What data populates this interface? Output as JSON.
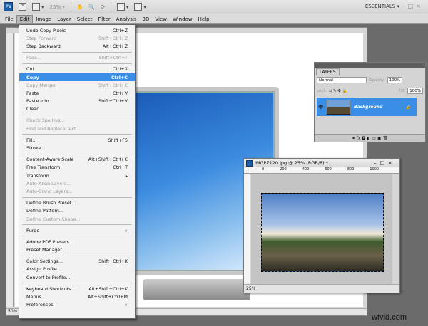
{
  "appbar": {
    "logo": "Ps",
    "bridge": "Br",
    "zoom": "25%",
    "workspace": "ESSENTIALS ▾",
    "window_controls": "–□×"
  },
  "menubar": [
    "File",
    "Edit",
    "Image",
    "Layer",
    "Select",
    "Filter",
    "Analysis",
    "3D",
    "View",
    "Window",
    "Help"
  ],
  "edit_menu": {
    "groups": [
      [
        {
          "label": "Undo Copy Pixels",
          "shortcut": "Ctrl+Z"
        },
        {
          "label": "Step Forward",
          "shortcut": "Shift+Ctrl+Z",
          "disabled": true
        },
        {
          "label": "Step Backward",
          "shortcut": "Alt+Ctrl+Z"
        }
      ],
      [
        {
          "label": "Fade...",
          "shortcut": "Shift+Ctrl+F",
          "disabled": true
        }
      ],
      [
        {
          "label": "Cut",
          "shortcut": "Ctrl+X"
        },
        {
          "label": "Copy",
          "shortcut": "Ctrl+C",
          "selected": true
        },
        {
          "label": "Copy Merged",
          "shortcut": "Shift+Ctrl+C",
          "disabled": true
        },
        {
          "label": "Paste",
          "shortcut": "Ctrl+V"
        },
        {
          "label": "Paste Into",
          "shortcut": "Shift+Ctrl+V"
        },
        {
          "label": "Clear",
          "shortcut": ""
        }
      ],
      [
        {
          "label": "Check Spelling...",
          "shortcut": "",
          "disabled": true
        },
        {
          "label": "Find and Replace Text...",
          "shortcut": "",
          "disabled": true
        }
      ],
      [
        {
          "label": "Fill...",
          "shortcut": "Shift+F5"
        },
        {
          "label": "Stroke...",
          "shortcut": ""
        }
      ],
      [
        {
          "label": "Content-Aware Scale",
          "shortcut": "Alt+Shift+Ctrl+C"
        },
        {
          "label": "Free Transform",
          "shortcut": "Ctrl+T"
        },
        {
          "label": "Transform",
          "shortcut": "▸"
        },
        {
          "label": "Auto-Align Layers...",
          "shortcut": "",
          "disabled": true
        },
        {
          "label": "Auto-Blend Layers...",
          "shortcut": "",
          "disabled": true
        }
      ],
      [
        {
          "label": "Define Brush Preset...",
          "shortcut": ""
        },
        {
          "label": "Define Pattern...",
          "shortcut": ""
        },
        {
          "label": "Define Custom Shape...",
          "shortcut": "",
          "disabled": true
        }
      ],
      [
        {
          "label": "Purge",
          "shortcut": "▸"
        }
      ],
      [
        {
          "label": "Adobe PDF Presets...",
          "shortcut": ""
        },
        {
          "label": "Preset Manager...",
          "shortcut": ""
        }
      ],
      [
        {
          "label": "Color Settings...",
          "shortcut": "Shift+Ctrl+K"
        },
        {
          "label": "Assign Profile...",
          "shortcut": ""
        },
        {
          "label": "Convert to Profile...",
          "shortcut": ""
        }
      ],
      [
        {
          "label": "Keyboard Shortcuts...",
          "shortcut": "Alt+Shift+Ctrl+K"
        },
        {
          "label": "Menus...",
          "shortcut": "Alt+Shift+Ctrl+M"
        },
        {
          "label": "Preferences",
          "shortcut": "▸"
        }
      ]
    ]
  },
  "main_doc": {
    "zoom": "50%"
  },
  "layers": {
    "tab": "LAYERS",
    "blend": "Normal",
    "opacity_label": "Opacity:",
    "opacity": "100%",
    "lock_label": "Lock:",
    "fill_label": "Fill:",
    "fill": "100%",
    "layer_name": "Background",
    "footer_icons": "⚭ fx ◘ ◐ ▭ ▣ 🗑"
  },
  "image_window": {
    "title": "IMGP7120.jpg @ 25% (RGB/8) *",
    "ruler": [
      "0",
      "200",
      "400",
      "600",
      "800",
      "1000"
    ],
    "zoom": "25%"
  },
  "watermark": "wtvid.com"
}
